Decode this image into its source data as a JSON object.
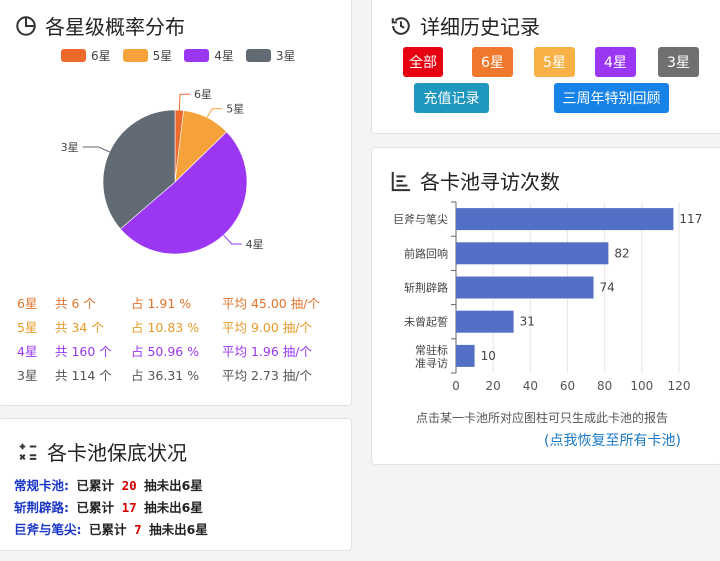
{
  "colors": {
    "six": "#ee6a2c",
    "five": "#f6a23a",
    "four": "#9b37f2",
    "three": "#626a74"
  },
  "dist": {
    "title": "各星级概率分布",
    "icon": "pie-chart-icon",
    "legend": [
      {
        "label": "6星",
        "color": "#ee6a2c"
      },
      {
        "label": "5星",
        "color": "#f6a23a"
      },
      {
        "label": "4星",
        "color": "#9b37f2"
      },
      {
        "label": "3星",
        "color": "#626a74"
      }
    ],
    "stats": [
      {
        "name": "6星",
        "count": "共 6 个",
        "pct": "占 1.91 %",
        "avg": "平均 45.00 抽/个",
        "color": "#e3742d"
      },
      {
        "name": "5星",
        "count": "共 34 个",
        "pct": "占 10.83 %",
        "avg": "平均 9.00 抽/个",
        "color": "#e89b29"
      },
      {
        "name": "4星",
        "count": "共 160 个",
        "pct": "占 50.96 %",
        "avg": "平均 1.96 抽/个",
        "color": "#9b37f2"
      },
      {
        "name": "3星",
        "count": "共 114 个",
        "pct": "占 36.31 %",
        "avg": "平均 2.73 抽/个",
        "color": "#555555"
      }
    ]
  },
  "chart_data": [
    {
      "type": "pie",
      "title": "",
      "labels": [
        "6星",
        "5星",
        "4星",
        "3星"
      ],
      "values": [
        6,
        34,
        160,
        114
      ],
      "colors": [
        "#ee6a2c",
        "#f6a23a",
        "#9b37f2",
        "#626a74"
      ],
      "legend": "top"
    },
    {
      "type": "bar",
      "orientation": "horizontal",
      "title": "",
      "categories": [
        "巨斧与笔尖",
        "前路回响",
        "斩荆辟路",
        "未曾起誓",
        "常驻标准寻访"
      ],
      "values": [
        117,
        82,
        74,
        31,
        10
      ],
      "xlim": [
        0,
        120
      ],
      "xticks": [
        "0",
        "20",
        "40",
        "60",
        "80",
        "100",
        "120"
      ],
      "xlabel": "",
      "ylabel": "",
      "color": "#5470c6",
      "grid": true
    }
  ],
  "history": {
    "title": "详细历史记录",
    "icon": "history-icon",
    "buttons": [
      {
        "label": "全部",
        "color": "#e60012"
      },
      {
        "label": "6星",
        "color": "#f0782d"
      },
      {
        "label": "5星",
        "color": "#f7b147"
      },
      {
        "label": "4星",
        "color": "#9b37f2"
      },
      {
        "label": "3星",
        "color": "#707070"
      },
      {
        "label": "充值记录",
        "color": "#1f97bf"
      },
      {
        "label": "三周年特别回顾",
        "color": "#1782e8"
      }
    ]
  },
  "pool": {
    "title": "各卡池寻访次数",
    "icon": "bar-chart-icon",
    "ylabels": [
      "巨斧与笔尖",
      "前路回响",
      "斩荆辟路",
      "未曾起誓",
      "常驻标",
      "准寻访"
    ],
    "value_labels": [
      "117",
      "82",
      "74",
      "31",
      "10"
    ],
    "note": "点击某一卡池所对应图柱可只生成此卡池的报告",
    "restore": "(点我恢复至所有卡池)"
  },
  "pity": {
    "title": "各卡池保底状况",
    "icon": "calculator-icon",
    "lines": [
      {
        "name": "常规卡池:",
        "prefix": "已累计",
        "num": "20",
        "suffix": "抽未出6星"
      },
      {
        "name": "斩荆辟路:",
        "prefix": "已累计",
        "num": "17",
        "suffix": "抽未出6星"
      },
      {
        "name": "巨斧与笔尖:",
        "prefix": "已累计",
        "num": "7",
        "suffix": "抽未出6星"
      }
    ]
  }
}
